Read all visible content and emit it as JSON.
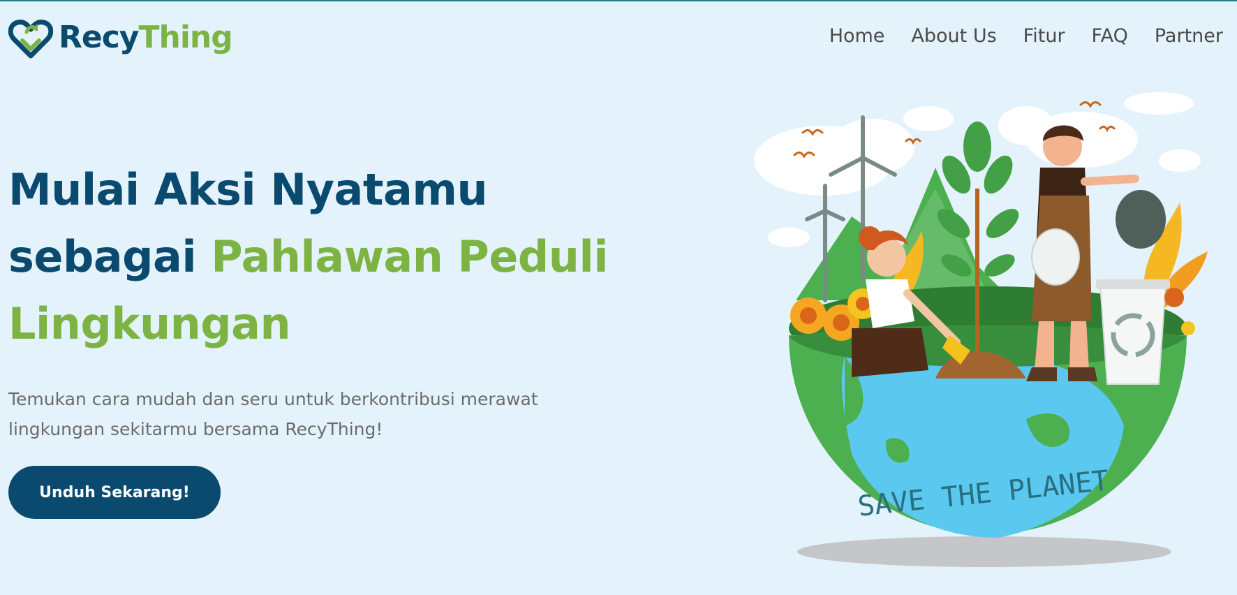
{
  "brand": {
    "name_part1": "Recy",
    "name_part2": "Thing"
  },
  "nav": {
    "items": [
      {
        "label": "Home"
      },
      {
        "label": "About Us"
      },
      {
        "label": "Fitur"
      },
      {
        "label": "FAQ"
      },
      {
        "label": "Partner"
      }
    ]
  },
  "hero": {
    "line1": "Mulai Aksi Nyatamu",
    "line2_prefix": "sebagai",
    "line2_highlight": "Pahlawan Peduli",
    "line3_highlight": "Lingkungan",
    "subtitle_line1": "Temukan cara mudah dan seru untuk berkontribusi merawat",
    "subtitle_line2": "lingkungan sekitarmu bersama RecyThing!",
    "cta_label": "Unduh Sekarang!"
  },
  "illustration": {
    "globe_text": "SAVE THE PLANET"
  },
  "colors": {
    "background": "#e4f3fb",
    "primary_blue": "#0b4a6f",
    "accent_green": "#7cb342",
    "nav_text": "#4a4a4a",
    "body_text": "#6b6b6b"
  }
}
